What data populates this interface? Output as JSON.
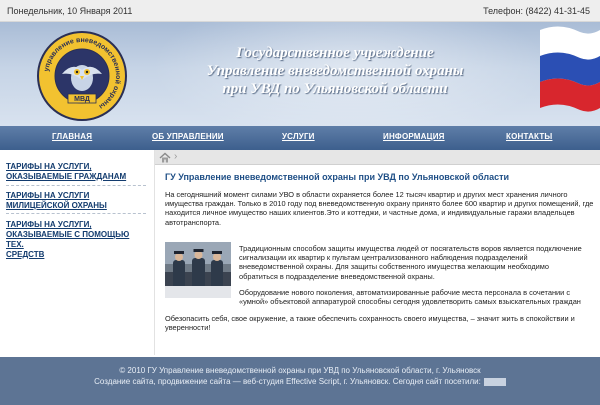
{
  "topbar": {
    "date": "Понедельник, 10 Января 2011",
    "phone": "Телефон: (8422) 41-31-45"
  },
  "header": {
    "title_line1": "Государственное учреждение",
    "title_line2": "Управление вневедомственной охраны",
    "title_line3": "при УВД по Ульяновской области",
    "emblem_text": "управление вневедомственной охраны",
    "emblem_abbr": "МВД"
  },
  "nav": {
    "items": [
      {
        "label": "ГЛАВНАЯ"
      },
      {
        "label": "ОБ УПРАВЛЕНИИ"
      },
      {
        "label": "УСЛУГИ"
      },
      {
        "label": "ИНФОРМАЦИЯ"
      },
      {
        "label": "КОНТАКТЫ"
      }
    ]
  },
  "sidebar": {
    "links": [
      {
        "line1": "ТАРИФЫ НА УСЛУГИ,",
        "line2": "ОКАЗЫВАЕМЫЕ ГРАЖДАНАМ"
      },
      {
        "line1": "ТАРИФЫ НА УСЛУГИ",
        "line2": "МИЛИЦЕЙСКОЙ ОХРАНЫ"
      },
      {
        "line1": "ТАРИФЫ НА УСЛУГИ,",
        "line2": "ОКАЗЫВАЕМЫЕ С ПОМОЩЬЮ ТЕХ.",
        "line3": "СРЕДСТВ"
      }
    ]
  },
  "main": {
    "page_title": "ГУ Управление вневедомственной охраны при УВД по Ульяновской области",
    "p1": [
      "На сегодняшний момент силами УВО в области охраняется более 12 тысяч квартир и других мест хранения личного",
      "имущества граждан. Только в 2010 году под вневедомственную охрану принято более 600  квартир и других помещений, где",
      "находится личное имущество наших клиентов.Это и коттеджи,  и частные дома, и индивидуальные гаражи владельцев",
      "автотранспорта."
    ],
    "p2": [
      "Традиционным способом защиты имущества людей от посягательств воров является подключение",
      "сигнализации их квартир к пультам централизованного наблюдения подразделений",
      "вневедомственной охраны. Для защиты собственного имущества желающим необходимо",
      "обратиться в подразделение вневедомственной охраны."
    ],
    "p3": [
      "Оборудование нового поколения, автоматизированные рабочие места персонала в сочетании с",
      "«умной» объектовой аппаратурой способны сегодня удовлетворить самых взыскательных граждан"
    ],
    "p4": [
      "Обезопасить себя, свое окружение, а также обеспечить сохранность своего имущества, – значит жить в спокойствии и",
      "уверенности!"
    ]
  },
  "footer": {
    "line1": "© 2010 ГУ Управление вневедомственной охраны при УВД по Ульяновской области, г. Ульяновск",
    "line2": "Создание сайта, продвижение сайта — веб-студия Effective Script, г. Ульяновск.  Сегодня сайт посетили:"
  },
  "colors": {
    "header_bg": "#b8c8de",
    "nav_bg": "#4a6a96",
    "link": "#123b6e",
    "title": "#1f4f86",
    "footer_bg": "#5d7494"
  },
  "icons": [
    "home-icon",
    "emblem-logo",
    "russian-flag"
  ]
}
